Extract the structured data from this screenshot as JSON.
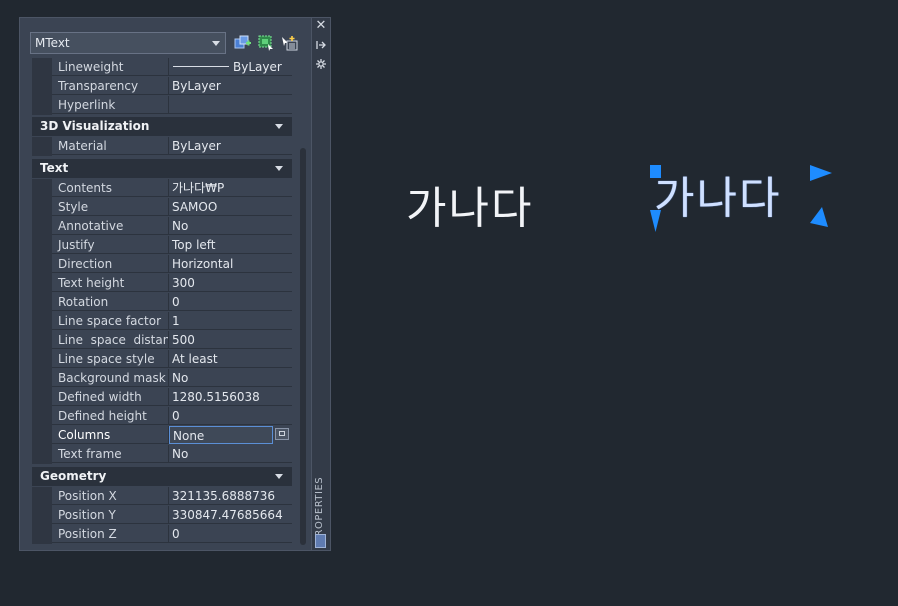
{
  "palette": {
    "object_type": "MText",
    "toolbar": {
      "quick_select_icon": "quick-select-icon",
      "select_objects_icon": "select-objects-icon",
      "pickadd_icon": "pickadd-toggle-icon"
    },
    "strip": {
      "close_icon": "close-icon",
      "autohide_icon": "autohide-icon",
      "properties_icon": "properties-menu-icon",
      "label": "PROPERTIES"
    },
    "general_tail": [
      {
        "name": "Lineweight",
        "value": "ByLayer",
        "has_line": true
      },
      {
        "name": "Transparency",
        "value": "ByLayer"
      },
      {
        "name": "Hyperlink",
        "value": ""
      }
    ],
    "sections": {
      "viz": {
        "title": "3D Visualization",
        "rows": [
          {
            "name": "Material",
            "value": "ByLayer"
          }
        ]
      },
      "text": {
        "title": "Text",
        "rows": [
          {
            "name": "Contents",
            "value": "가나다₩P"
          },
          {
            "name": "Style",
            "value": "SAMOO"
          },
          {
            "name": "Annotative",
            "value": "No"
          },
          {
            "name": "Justify",
            "value": "Top left"
          },
          {
            "name": "Direction",
            "value": "Horizontal"
          },
          {
            "name": "Text height",
            "value": "300"
          },
          {
            "name": "Rotation",
            "value": "0"
          },
          {
            "name": "Line space factor",
            "value": "1"
          },
          {
            "name": "Line  space  distan...",
            "value": "500"
          },
          {
            "name": "Line space style",
            "value": "At least"
          },
          {
            "name": "Background mask",
            "value": "No"
          },
          {
            "name": "Defined width",
            "value": "1280.5156038"
          },
          {
            "name": "Defined height",
            "value": "0"
          },
          {
            "name": "Columns",
            "value": "None"
          },
          {
            "name": "Text frame",
            "value": "No"
          }
        ]
      },
      "geometry": {
        "title": "Geometry",
        "rows": [
          {
            "name": "Position X",
            "value": "321135.6888736"
          },
          {
            "name": "Position Y",
            "value": "330847.47685664"
          },
          {
            "name": "Position Z",
            "value": "0"
          }
        ]
      }
    }
  },
  "drawing": {
    "text_plain": "가나다",
    "text_selected": "가나다",
    "grip_color": "#1e8cff"
  },
  "colors": {
    "background": "#212830",
    "panel": "#3b4453",
    "section_header": "#2a313c"
  }
}
